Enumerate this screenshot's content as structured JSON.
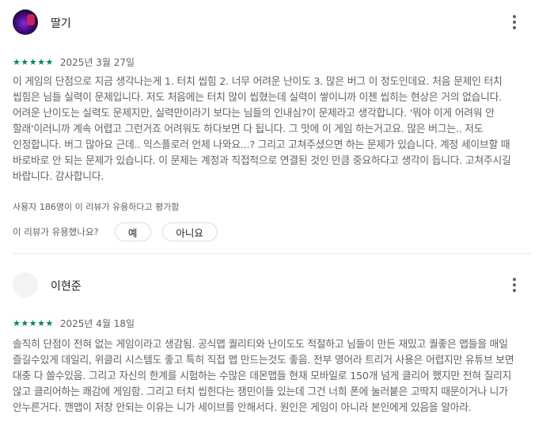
{
  "reviews": [
    {
      "author": "딸기",
      "stars": "★★★★★",
      "rating": 5,
      "date": "2025년 3월 27일",
      "text": "이 게임의 단점으로 지금 생각나는게 1. 터치 씹힘 2. 너무 어려운 난이도 3. 많은 버그 이 정도인데요. 처음 문제인 터치 씹힘은 님들 실력이 문제입니다. 저도 처음에는 터치 많이 씹혔는데 실력이 쌓이니까 이젠 씹히는 현상은 거의 없습니다. 어려운 난이도는 실력도 문제지만, 실력만이라기 보다는 님들의 인내심?이 문제라고 생각합니다. '뭐야 이게 어려워 안 할래'이러니까 계속 어렵고 그런거죠 어려워도 하다보면 다 됩니다. 그 맛에 이 게임 하는거고요. 많은 버그는.. 저도 인정합니다. 버그 많아요 근데.. 익스플로러 언제 나와요...? 그리고 고쳐주셨으면 하는 문제가 있습니다. 계정 세이브할 때 바로바로 안 되는 문제가 있습니다. 이 문제는 계정과 직접적으로 연결된 것인 만큼 중요하다고 생각이 듭니다. 고쳐주시길 바랍니다. 감사합니다.",
      "helpful_count": "사용자 186명이 이 리뷰가 유용하다고 평가함",
      "helpful_question": "이 리뷰가 유용했나요?",
      "yes_label": "예",
      "no_label": "아니요"
    },
    {
      "author": "이현준",
      "stars": "★★★★★",
      "rating": 5,
      "date": "2025년 4월 18일",
      "text": "솔직히 단점이 전혀 없는 게임이라고 생감됨. 공식맵 퀄리티와 난이도도 적절하고 님들이 만든 재밌고 퀄좋은 맵들을 매일 즐길수있게 데일리, 위클리 시스템도 좋고 특히 직접 맵 만드는것도 좋음. 전부 영어라 트리거 사용은 어렵지만 유튜브 보면 대충 다 쓸수있음. 그리고 자신의 한계를 시험하는 수많은 데몬맵들 현재 모바일로 150개 넘게 클리어 했지만 전혀 질리지 않고 클리어하는 쾌감에 게임함. 그리고 터치 씹힌다는 잼민이들 있는데 그건 너희 폰에 눌러붙은 고딱지 때문이거나 니가 안누른거다. 깬맵이 저장 안되는 이유는 니가 세이브를 안해서다. 원인은 게임이 아니라 본인에게 있음을 알아라."
    }
  ],
  "icons": {
    "more": "more-vert-icon",
    "star": "star-icon"
  },
  "colors": {
    "star": "#01875f",
    "text": "#5f6368",
    "name": "#202124",
    "border": "#dadce0"
  }
}
